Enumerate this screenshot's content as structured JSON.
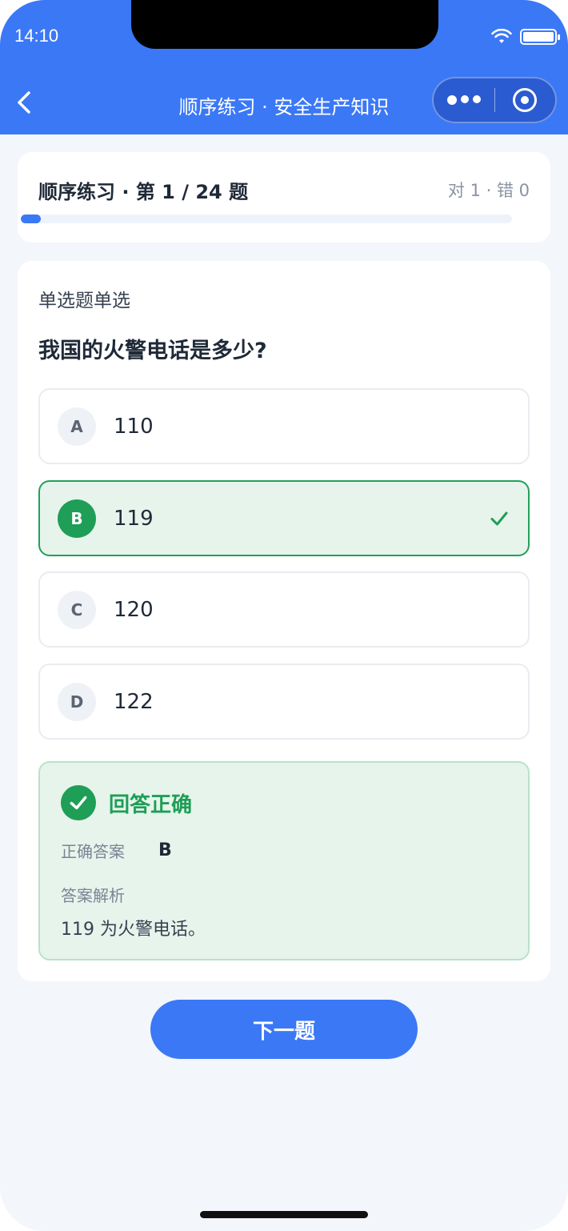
{
  "status": {
    "time": "14:10"
  },
  "nav": {
    "title": "顺序练习 · 安全生产知识"
  },
  "progress": {
    "title": "顺序练习 · 第 1 / 24 题",
    "stats": "对 1 · 错 0",
    "fraction": 0.04
  },
  "question": {
    "type_label": "单选题单选",
    "text": "我国的火警电话是多少?",
    "options": [
      {
        "letter": "A",
        "text": "110"
      },
      {
        "letter": "B",
        "text": "119"
      },
      {
        "letter": "C",
        "text": "120"
      },
      {
        "letter": "D",
        "text": "122"
      }
    ]
  },
  "feedback": {
    "title": "回答正确",
    "answer_label": "正确答案",
    "answer_value": "B",
    "explanation_label": "答案解析",
    "explanation_text": "119 为火警电话。"
  },
  "actions": {
    "next_label": "下一题"
  },
  "colors": {
    "primary": "#3b78f6",
    "success": "#1e9e56",
    "success_bg": "#e6f4ec"
  }
}
